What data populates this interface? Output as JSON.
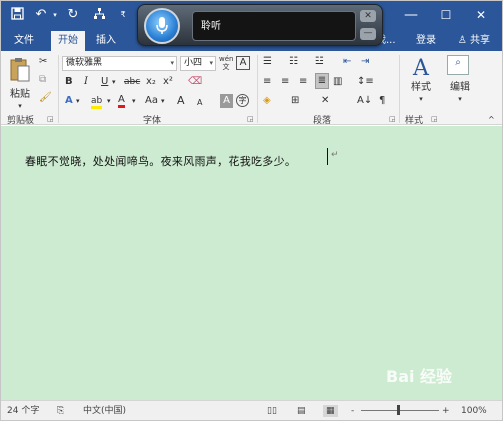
{
  "titlebar": {
    "save_icon": "save-icon",
    "undo_icon": "undo-icon",
    "redo_icon": "redo-icon",
    "customize_icon": "customize-icon",
    "window_buttons": [
      "—",
      "☐",
      "✕"
    ]
  },
  "tabs": {
    "file": "文件",
    "home": "开始",
    "insert": "插入",
    "partial_tab": "亦我...",
    "login": "登录",
    "share": "共享"
  },
  "speech": {
    "status": "聆听"
  },
  "ribbon": {
    "clipboard": {
      "paste_label": "粘贴",
      "group_label": "剪贴板"
    },
    "font": {
      "font_name": "微软雅黑",
      "font_size": "小四",
      "phonetic": "wén",
      "bold": "B",
      "italic": "I",
      "underline": "U",
      "strikethrough": "abc",
      "subscript": "x₂",
      "superscript": "x²",
      "change_case": "Aa",
      "grow": "A",
      "shrink": "A",
      "char_shading": "A",
      "enclosed": "字",
      "group_label": "字体"
    },
    "paragraph": {
      "group_label": "段落"
    },
    "styles": {
      "styles_label": "样式",
      "group_label": "样式"
    },
    "editing": {
      "editing_label": "编辑"
    }
  },
  "document": {
    "text": "春眠不觉晓，处处闻啼鸟。夜来风雨声，花我吃多少。"
  },
  "statusbar": {
    "word_count": "24 个字",
    "language": "中文(中国)",
    "zoom_minus": "-",
    "zoom_plus": "+",
    "zoom": "100%"
  },
  "watermark": {
    "text": "Bai 经验"
  }
}
